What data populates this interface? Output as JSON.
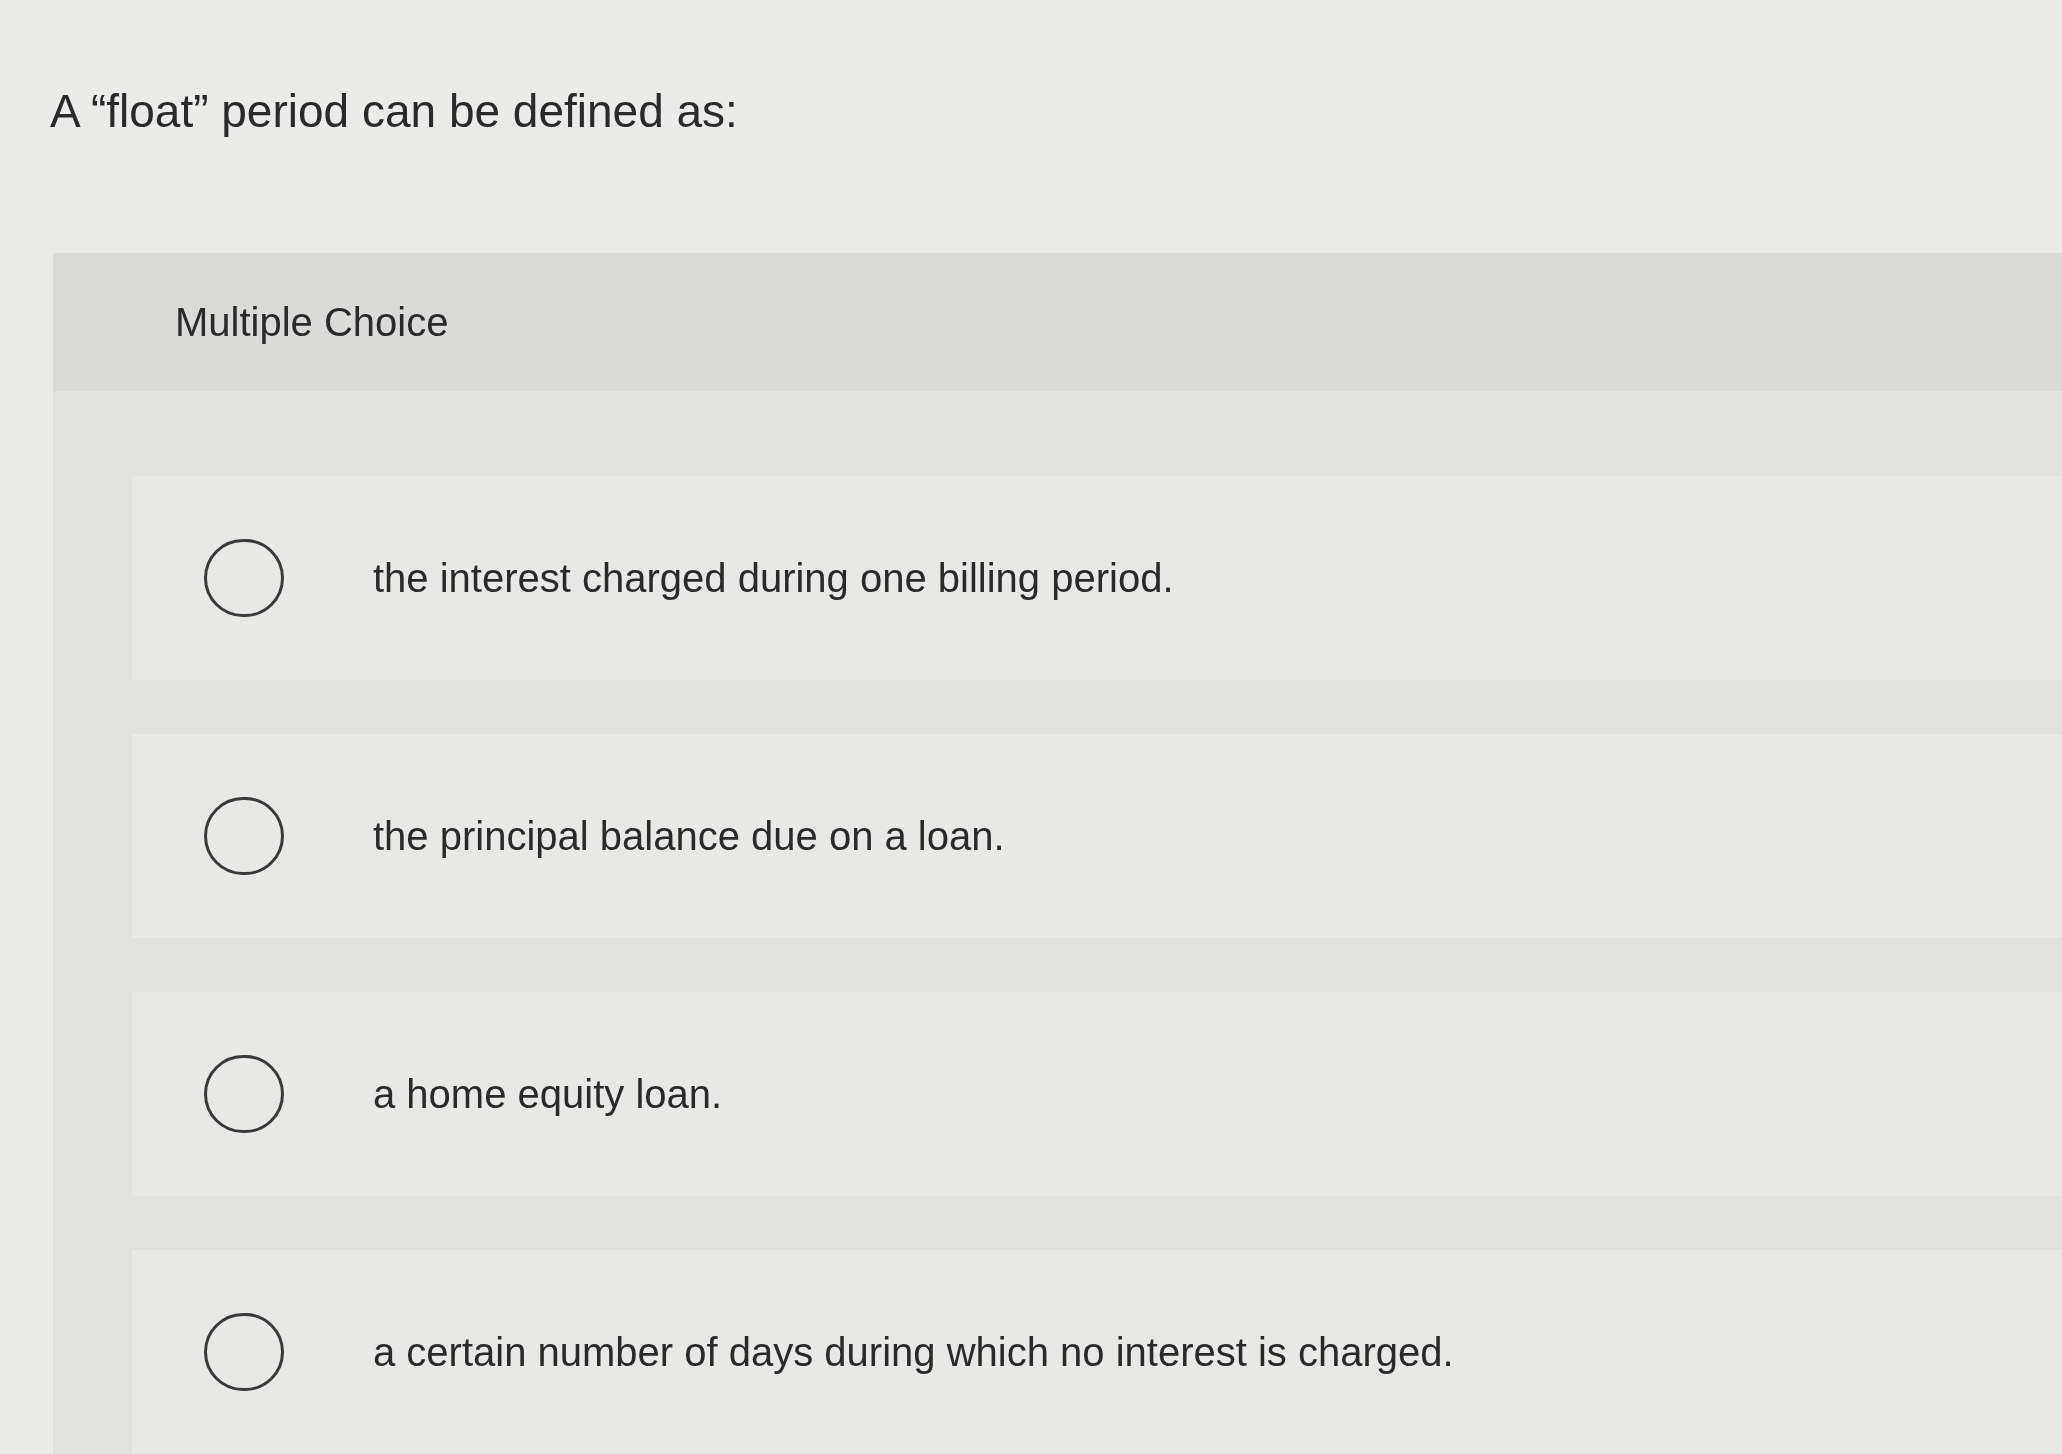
{
  "question": "A “float” period can be defined as:",
  "panel": {
    "heading": "Multiple Choice",
    "options": [
      {
        "text": "the interest charged during one billing period.",
        "selected": false
      },
      {
        "text": "the principal balance due on a loan.",
        "selected": false
      },
      {
        "text": "a home equity loan.",
        "selected": false
      },
      {
        "text": "a certain number of days during which no interest is charged.",
        "selected": false
      }
    ]
  }
}
